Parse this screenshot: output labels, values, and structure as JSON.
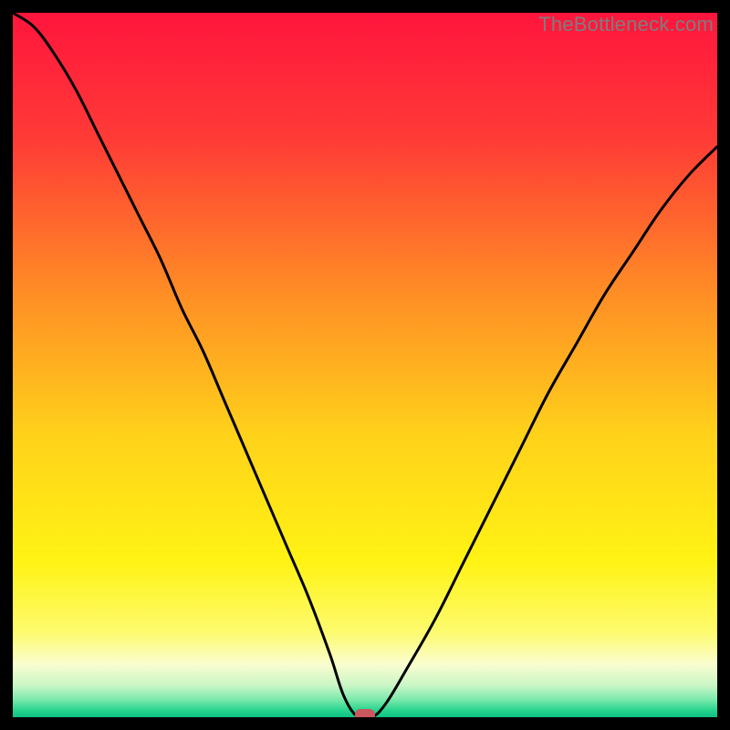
{
  "watermark": "TheBottleneck.com",
  "chart_data": {
    "type": "line",
    "title": "",
    "xlabel": "",
    "ylabel": "",
    "xlim": [
      0,
      100
    ],
    "ylim": [
      0,
      100
    ],
    "optimum_x": 49,
    "series": [
      {
        "name": "bottleneck-curve",
        "x": [
          0,
          3,
          6,
          9,
          12,
          15,
          18,
          21,
          24,
          27,
          30,
          33,
          36,
          39,
          42,
          45,
          47,
          49,
          51,
          53,
          56,
          60,
          64,
          68,
          72,
          76,
          80,
          84,
          88,
          92,
          96,
          100
        ],
        "y": [
          100,
          98,
          94,
          89,
          83,
          77,
          71,
          65,
          58,
          52,
          45,
          38,
          31,
          24,
          17,
          9,
          3,
          0,
          0,
          2,
          7,
          14,
          22,
          30,
          38,
          46,
          53,
          60,
          66,
          72,
          77,
          81
        ]
      }
    ],
    "marker": {
      "x": 50,
      "y": 0,
      "color": "#c9575d"
    },
    "gradient_stops": [
      {
        "offset": 0.0,
        "color": "#ff153d"
      },
      {
        "offset": 0.18,
        "color": "#ff3b36"
      },
      {
        "offset": 0.4,
        "color": "#ff8e25"
      },
      {
        "offset": 0.6,
        "color": "#ffd21a"
      },
      {
        "offset": 0.78,
        "color": "#fff314"
      },
      {
        "offset": 0.88,
        "color": "#fdfb6f"
      },
      {
        "offset": 0.925,
        "color": "#fafdd0"
      },
      {
        "offset": 0.955,
        "color": "#c9f6c5"
      },
      {
        "offset": 0.975,
        "color": "#7be9ac"
      },
      {
        "offset": 0.99,
        "color": "#27d48e"
      },
      {
        "offset": 1.0,
        "color": "#0fc183"
      }
    ]
  }
}
